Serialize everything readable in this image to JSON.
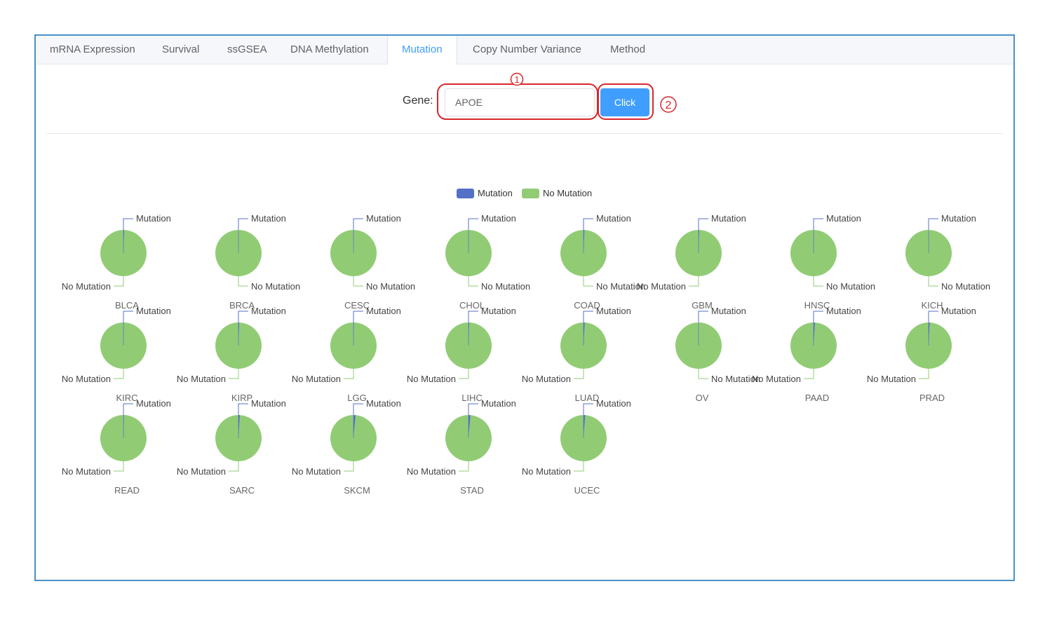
{
  "tabs": [
    {
      "label": "mRNA Expression",
      "active": false
    },
    {
      "label": "Survival",
      "active": false
    },
    {
      "label": "ssGSEA",
      "active": false
    },
    {
      "label": "DNA Methylation",
      "active": false
    },
    {
      "label": "Mutation",
      "active": true
    },
    {
      "label": "Copy Number Variance",
      "active": false
    },
    {
      "label": "Method",
      "active": false
    }
  ],
  "form": {
    "gene_label": "Gene:",
    "gene_value": "APOE",
    "button_label": "Click"
  },
  "annotations": {
    "marker_1": "1",
    "marker_2": "2",
    "color": "#d9262c"
  },
  "colors": {
    "mutation": "#5470c6",
    "no_mutation": "#91cc75",
    "accent": "#409eff"
  },
  "chart_data": {
    "type": "pie",
    "legend": [
      "Mutation",
      "No Mutation"
    ],
    "legend_position": "top-center",
    "slice_labels": [
      "Mutation",
      "No Mutation"
    ],
    "pies": [
      {
        "name": "BLCA",
        "mutation": 0.6,
        "no_mutation": 99.4
      },
      {
        "name": "BRCA",
        "mutation": 0.1,
        "no_mutation": 99.9
      },
      {
        "name": "CESC",
        "mutation": 0.3,
        "no_mutation": 99.7
      },
      {
        "name": "CHOL",
        "mutation": 0.2,
        "no_mutation": 99.8
      },
      {
        "name": "COAD",
        "mutation": 0.7,
        "no_mutation": 99.3
      },
      {
        "name": "GBM",
        "mutation": 0.5,
        "no_mutation": 99.5
      },
      {
        "name": "HNSC",
        "mutation": 0.2,
        "no_mutation": 99.8
      },
      {
        "name": "KICH",
        "mutation": 0.1,
        "no_mutation": 99.9
      },
      {
        "name": "KIRC",
        "mutation": 0.3,
        "no_mutation": 99.7
      },
      {
        "name": "KIRP",
        "mutation": 0.6,
        "no_mutation": 99.4
      },
      {
        "name": "LGG",
        "mutation": 0.4,
        "no_mutation": 99.6
      },
      {
        "name": "LIHC",
        "mutation": 0.5,
        "no_mutation": 99.5
      },
      {
        "name": "LUAD",
        "mutation": 0.9,
        "no_mutation": 99.1
      },
      {
        "name": "OV",
        "mutation": 0.1,
        "no_mutation": 99.9
      },
      {
        "name": "PAAD",
        "mutation": 1.0,
        "no_mutation": 99.0
      },
      {
        "name": "PRAD",
        "mutation": 0.8,
        "no_mutation": 99.2
      },
      {
        "name": "READ",
        "mutation": 0.4,
        "no_mutation": 99.6
      },
      {
        "name": "SARC",
        "mutation": 1.0,
        "no_mutation": 99.0
      },
      {
        "name": "SKCM",
        "mutation": 1.5,
        "no_mutation": 98.5
      },
      {
        "name": "STAD",
        "mutation": 1.4,
        "no_mutation": 98.6
      },
      {
        "name": "UCEC",
        "mutation": 1.2,
        "no_mutation": 98.8
      }
    ]
  }
}
